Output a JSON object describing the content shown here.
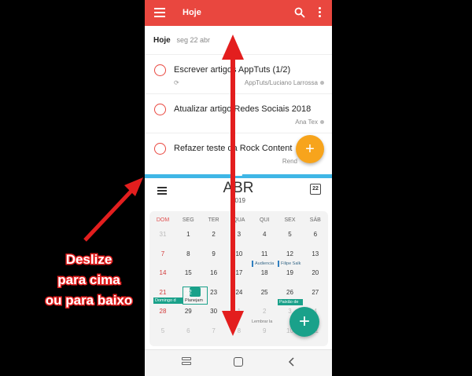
{
  "tasks_app": {
    "title": "Hoje",
    "section_day": "Hoje",
    "section_date": "seg 22 abr",
    "tasks": [
      {
        "text": "Escrever artigos AppTuts (1/2)",
        "meta": "AppTuts/Luciano Larrossa",
        "repeat": "⟳"
      },
      {
        "text": "Atualizar artigo Redes Sociais 2018",
        "meta": "Ana Tex",
        "repeat": ""
      },
      {
        "text": "Refazer teste da Rock Content",
        "meta": "Rend",
        "repeat": ""
      }
    ],
    "fab": "+"
  },
  "calendar_app": {
    "month": "ABR",
    "year": "2019",
    "today_icon": "22",
    "weekdays": [
      "DOM",
      "SEG",
      "TER",
      "QUA",
      "QUI",
      "SEX",
      "SÁB"
    ],
    "weeks": [
      [
        "31",
        "1",
        "2",
        "3",
        "4",
        "5",
        "6"
      ],
      [
        "7",
        "8",
        "9",
        "10",
        "11",
        "12",
        "13"
      ],
      [
        "14",
        "15",
        "16",
        "17",
        "18",
        "19",
        "20"
      ],
      [
        "21",
        "22",
        "23",
        "24",
        "25",
        "26",
        "27"
      ],
      [
        "28",
        "29",
        "30",
        "1",
        "2",
        "3",
        "4"
      ],
      [
        "5",
        "6",
        "7",
        "8",
        "9",
        "10",
        "11"
      ]
    ],
    "events": {
      "audiencia": "Audiencia",
      "filipe": "Filipe Salk",
      "paixao": "Paixão de",
      "domingo": "Domingo d",
      "planejam": "Planejam",
      "lembrar": "Lembrar la"
    },
    "fab": "+"
  },
  "annotation": {
    "line1": "Deslize",
    "line2": "para cima",
    "line3": "ou para baixo"
  },
  "colors": {
    "tasks_accent": "#e9473f",
    "task_fab": "#f7a41c",
    "divider": "#3fb6e6",
    "calendar_accent": "#1aa18a",
    "annotation_red": "#e31e1e"
  }
}
